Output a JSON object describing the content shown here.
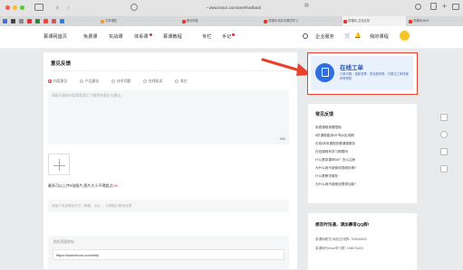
{
  "browser": {
    "url": "www.imooc.com/user/feedback",
    "tabs": [
      "万事得图",
      "鹿马网营",
      "慕课网-精彩无限的学习",
      "慕课网_意见反馈",
      "慕课网-MAS"
    ]
  },
  "nav": {
    "items": [
      "慕课网首页",
      "免费课",
      "实战课",
      "体系课",
      "慕课教程",
      "专栏",
      "手记"
    ],
    "search_icon": "search-icon",
    "right_items": [
      "企业服务",
      "消息",
      "我的课程"
    ]
  },
  "feedback": {
    "title": "意见反馈",
    "categories": [
      "内容意见",
      "产品建议",
      "技术问题",
      "在线投诉",
      "其它"
    ],
    "textarea_placeholder": "请填写具体内容帮助我们了解您的意见与建议。",
    "char_count": "500",
    "upload_note": "最多可以上传5张图片,图片大小不得超过",
    "upload_limit": "2M",
    "contact_placeholder": "请留下真实联系方式（邮箱、QQ），方便我们联系处理",
    "page_url_label": "相关页面地址:",
    "page_url_value": "https://www.imooc.com/help"
  },
  "online_service": {
    "title": "在线工单",
    "desc": "订单问题、退款发票、常见服务等、可提交工单快速获得帮助"
  },
  "faq": {
    "title": "常见反馈",
    "items": [
      "免费课程观看限制",
      "8折课程能用VIP吗&实用期",
      "在线/体系课程查看课程服务",
      "在线课程有学习期限吗",
      "什么是慕课网Git？怎么注册",
      "为什么我不能使用视频存储?",
      "什么是教学服务",
      "为什么我不能使用提现功能?"
    ]
  },
  "contact": {
    "title": "想及时沟通，请加慕客QQ群!",
    "lines": [
      "慕课网职员-网站交流群: 705645002",
      "慕课网Python学习群: 158976420"
    ]
  },
  "colors": {
    "accent_red": "#e4393c",
    "arrow_red": "#e8412c",
    "service_blue": "#2f6fe0",
    "service_bg": "#e9f1fd"
  }
}
